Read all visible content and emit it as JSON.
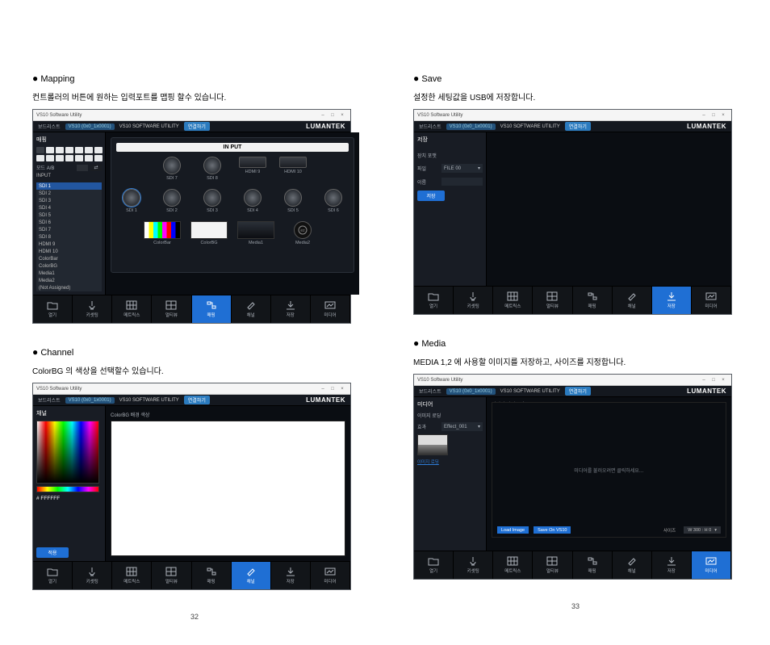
{
  "brand": "LUMANTEK",
  "app_title": "VS10 Software Utility",
  "software_label": "VS10 SOFTWARE UTILITY",
  "toolbar": {
    "device_label": "보드리스트",
    "device_value": "VS10 (0x0_1x0001)",
    "connect": "연결하기"
  },
  "sections": {
    "mapping": {
      "heading": "Mapping",
      "desc": "컨트롤러의 버튼에 원하는 입력포트를  맵핑 할수 있습니다."
    },
    "save": {
      "heading": "Save",
      "desc": "설정한 세팅값을 USB에 저장합니다."
    },
    "channel": {
      "heading": "Channel",
      "desc": "ColorBG 의 색상을 선택할수 있습니다."
    },
    "media": {
      "heading": "Media",
      "desc": "MEDIA 1,2 에 사용할 이미지를 저장하고, 사이즈를 지정합니다."
    }
  },
  "tabs": {
    "t0": "열기",
    "t1": "키셋팅",
    "t2": "메트릭스",
    "t3": "멀티뷰",
    "t4": "매핑",
    "t5": "채널",
    "t6": "저장",
    "t7": "미디어"
  },
  "mapping": {
    "panel_title": "매핑",
    "bus_label": "모드 A/B",
    "input_label": "INPUT",
    "list": [
      "SDI 1",
      "SDI 2",
      "SDI 3",
      "SDI 4",
      "SDI 5",
      "SDI 6",
      "SDI 7",
      "SDI 8",
      "HDMI 9",
      "HDMI 10",
      "ColorBar",
      "ColorBG",
      "Media1",
      "Media2",
      "(Not Assigned)"
    ],
    "ports_top": [
      {
        "label": "SDI 7"
      },
      {
        "label": "SDI 8"
      },
      {
        "label": "HDMI 9",
        "type": "hdmi"
      },
      {
        "label": "HDMI 10",
        "type": "hdmi"
      }
    ],
    "ports_mid": [
      {
        "label": "SDI 1",
        "sel": true
      },
      {
        "label": "SDI 2"
      },
      {
        "label": "SDI 3"
      },
      {
        "label": "SDI 4"
      },
      {
        "label": "SDI 5"
      },
      {
        "label": "SDI 6"
      }
    ],
    "sources": [
      {
        "label": "ColorBar",
        "type": "colorbar"
      },
      {
        "label": "ColorBG",
        "type": "white"
      },
      {
        "label": "Media1",
        "type": "dev"
      },
      {
        "label": "Media2",
        "type": "circ"
      }
    ],
    "input_title": "IN PUT"
  },
  "save": {
    "panel_title": "저장",
    "format_label": "장치 포맷",
    "file_label": "파일",
    "file_value": "FILE 00",
    "name_label": "이름",
    "save_btn": "저장"
  },
  "channel": {
    "panel_title": "채널",
    "sub_title": "ColorBG 배경 색상",
    "hex": "# FFFFFF",
    "confirm": "적용"
  },
  "media": {
    "panel_title": "미디어",
    "load_label": "이미지 로딩",
    "effect_label": "효과",
    "effect_value": "Effect_001",
    "del_link": "이미지 로딩",
    "main_text": "미디어를 불러오려면 클릭하세요…",
    "footer_btn1": "Load Image",
    "footer_btn2": "Save On VS10",
    "footer_size_label": "사이즈",
    "footer_size_value": "W 300 : H 0"
  },
  "page_left": "32",
  "page_right": "33",
  "titlebar_close": "×",
  "titlebar_min": "–",
  "titlebar_max": "□"
}
